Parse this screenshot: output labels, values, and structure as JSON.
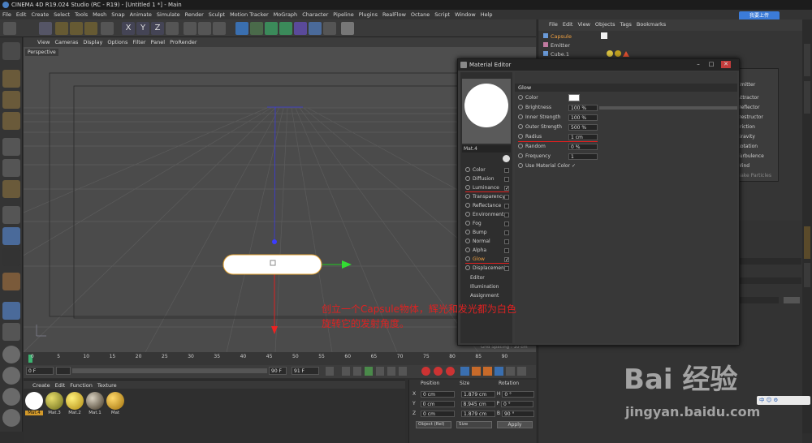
{
  "window": {
    "title": "CINEMA 4D R19.024 Studio (RC - R19) - [Untitled 1 *] - Main",
    "upload_label": "我要上传"
  },
  "menu": [
    "File",
    "Edit",
    "Create",
    "Select",
    "Tools",
    "Mesh",
    "Snap",
    "Animate",
    "Simulate",
    "Render",
    "Sculpt",
    "Motion Tracker",
    "MoGraph",
    "Character",
    "Pipeline",
    "Plugins",
    "RealFlow",
    "Octane",
    "Script",
    "Window",
    "Help"
  ],
  "viewport": {
    "menu": [
      "View",
      "Cameras",
      "Display",
      "Options",
      "Filter",
      "Panel",
      "ProRender"
    ],
    "label": "Perspective",
    "grid_spacing": "Grid Spacing : 10 cm"
  },
  "timeline": {
    "ticks": [
      "0",
      "5",
      "10",
      "15",
      "20",
      "25",
      "30",
      "35",
      "40",
      "45",
      "50",
      "55",
      "60",
      "65",
      "70",
      "75",
      "80",
      "85",
      "90"
    ],
    "frame_start": "0 F",
    "frame_current": "0 F",
    "frame_end_a": "90 F",
    "frame_end_b": "91 F",
    "end_marker": "0 F"
  },
  "materials": {
    "menu": [
      "Create",
      "Edit",
      "Function",
      "Texture"
    ],
    "items": [
      {
        "name": "Mat.4",
        "color": "#ffffff"
      },
      {
        "name": "Mat.3",
        "color": "#c9b21a"
      },
      {
        "name": "Mat.2",
        "color": "#e7c11a"
      },
      {
        "name": "Mat.1",
        "color": "#8a7a5c"
      },
      {
        "name": "Mat",
        "color": "#d8a72a"
      }
    ]
  },
  "coordinates": {
    "headers": [
      "Position",
      "Size",
      "Rotation"
    ],
    "rows": [
      {
        "axis": "X",
        "pos": "0 cm",
        "size": "1.879 cm",
        "rot_axis": "H",
        "rot": "0 °"
      },
      {
        "axis": "Y",
        "pos": "0 cm",
        "size": "8.945 cm",
        "rot_axis": "P",
        "rot": "0 °"
      },
      {
        "axis": "Z",
        "pos": "0 cm",
        "size": "1.879 cm",
        "rot_axis": "B",
        "rot": "90 °"
      }
    ],
    "mode_select": "Object (Rel)",
    "size_select": "Size",
    "apply_label": "Apply"
  },
  "object_manager": {
    "menu": [
      "File",
      "Edit",
      "View",
      "Objects",
      "Tags",
      "Bookmarks"
    ],
    "objects": [
      "Capsule",
      "Emitter",
      "Cube.1"
    ]
  },
  "side_list": [
    "Emitter",
    "Attractor",
    "Deflector",
    "Destructor",
    "Friction",
    "Gravity",
    "Rotation",
    "Turbulence",
    "Wind",
    "Bake Particles"
  ],
  "material_editor": {
    "title": "Material Editor",
    "mat_name": "Mat.4",
    "channels": [
      {
        "label": "Color",
        "checked": false
      },
      {
        "label": "Diffusion",
        "checked": false
      },
      {
        "label": "Luminance",
        "checked": true
      },
      {
        "label": "Transparency",
        "checked": false
      },
      {
        "label": "Reflectance",
        "checked": false
      },
      {
        "label": "Environment",
        "checked": false
      },
      {
        "label": "Fog",
        "checked": false
      },
      {
        "label": "Bump",
        "checked": false
      },
      {
        "label": "Normal",
        "checked": false
      },
      {
        "label": "Alpha",
        "checked": false
      },
      {
        "label": "Glow",
        "checked": true
      },
      {
        "label": "Displacement",
        "checked": false
      }
    ],
    "extra": [
      "Editor",
      "Illumination",
      "Assignment"
    ],
    "section": "Glow",
    "props": [
      {
        "label": "Color",
        "value": ""
      },
      {
        "label": "Brightness",
        "value": "100 %"
      },
      {
        "label": "Inner Strength",
        "value": "100 %"
      },
      {
        "label": "Outer Strength",
        "value": "500 %"
      },
      {
        "label": "Radius",
        "value": "1 cm"
      },
      {
        "label": "Random",
        "value": "0 %"
      },
      {
        "label": "Frequency",
        "value": "1"
      },
      {
        "label": "Use Material Color",
        "value": "✓"
      }
    ]
  },
  "annotation": {
    "line1": "创立一个Capsule物体，辉光和发光都为白色",
    "line2": "旋转它的发射角度。"
  },
  "watermark": {
    "main": "Bai 经验",
    "sub": "jingyan.baidu.com"
  },
  "ime": "中 ☺ ⚙"
}
